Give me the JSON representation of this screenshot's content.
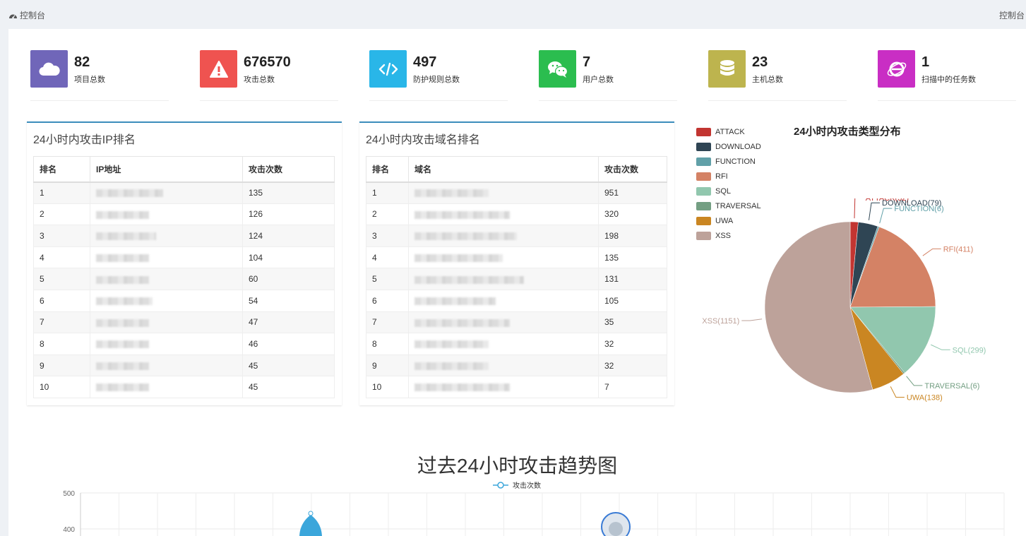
{
  "header": {
    "left_label": "控制台",
    "right_label": "控制台",
    "icon": "dashboard-icon"
  },
  "stats": [
    {
      "value": "82",
      "label": "项目总数",
      "icon": "cloud-icon",
      "color": "#7066b9"
    },
    {
      "value": "676570",
      "label": "攻击总数",
      "icon": "warning-icon",
      "color": "#ef5350"
    },
    {
      "value": "497",
      "label": "防护规则总数",
      "icon": "code-icon",
      "color": "#29b6e8"
    },
    {
      "value": "7",
      "label": "用户总数",
      "icon": "wechat-icon",
      "color": "#2bbd4f"
    },
    {
      "value": "23",
      "label": "主机总数",
      "icon": "database-icon",
      "color": "#bdb44e"
    },
    {
      "value": "1",
      "label": "扫描中的任务数",
      "icon": "internet-explorer-icon",
      "color": "#c92ec4"
    }
  ],
  "ip_ranking": {
    "title": "24小时内攻击IP排名",
    "headers": [
      "排名",
      "IP地址",
      "攻击次数"
    ],
    "rows": [
      {
        "rank": "1",
        "count": "135"
      },
      {
        "rank": "2",
        "count": "126"
      },
      {
        "rank": "3",
        "count": "124"
      },
      {
        "rank": "4",
        "count": "104"
      },
      {
        "rank": "5",
        "count": "60"
      },
      {
        "rank": "6",
        "count": "54"
      },
      {
        "rank": "7",
        "count": "47"
      },
      {
        "rank": "8",
        "count": "46"
      },
      {
        "rank": "9",
        "count": "45"
      },
      {
        "rank": "10",
        "count": "45"
      }
    ]
  },
  "domain_ranking": {
    "title": "24小时内攻击域名排名",
    "headers": [
      "排名",
      "域名",
      "攻击次数"
    ],
    "rows": [
      {
        "rank": "1",
        "count": "951"
      },
      {
        "rank": "2",
        "count": "320"
      },
      {
        "rank": "3",
        "count": "198"
      },
      {
        "rank": "4",
        "count": "135"
      },
      {
        "rank": "5",
        "count": "131"
      },
      {
        "rank": "6",
        "count": "105"
      },
      {
        "rank": "7",
        "count": "35"
      },
      {
        "rank": "8",
        "count": "32"
      },
      {
        "rank": "9",
        "count": "32"
      },
      {
        "rank": "10",
        "count": "7"
      }
    ]
  },
  "chart_data": [
    {
      "type": "pie",
      "title": "24小时内攻击类型分布",
      "legend_placement": "top-left",
      "slices": [
        {
          "name": "ATTACK",
          "value": 32,
          "label": "ATTACK(32)",
          "color": "#c23531"
        },
        {
          "name": "DOWNLOAD",
          "value": 79,
          "label": "DOWNLOAD(79)",
          "color": "#2f4554"
        },
        {
          "name": "FUNCTION",
          "value": 6,
          "label": "FUNCTION(6)",
          "color": "#61a0a8"
        },
        {
          "name": "RFI",
          "value": 411,
          "label": "RFI(411)",
          "color": "#d48265"
        },
        {
          "name": "SQL",
          "value": 299,
          "label": "SQL(299)",
          "color": "#91c7ae"
        },
        {
          "name": "TRAVERSAL",
          "value": 6,
          "label": "TRAVERSAL(6)",
          "color": "#749f83"
        },
        {
          "name": "UWA",
          "value": 138,
          "label": "UWA(138)",
          "color": "#ca8622"
        },
        {
          "name": "XSS",
          "value": 1151,
          "label": "XSS(1151)",
          "color": "#bda29a"
        }
      ]
    },
    {
      "type": "line",
      "title": "过去24小时攻击趋势图",
      "series": [
        {
          "name": "攻击次数",
          "color": "#3ba6db"
        }
      ],
      "y_ticks": [
        "500",
        "400"
      ],
      "ylim": [
        0,
        500
      ],
      "grid": true
    }
  ]
}
